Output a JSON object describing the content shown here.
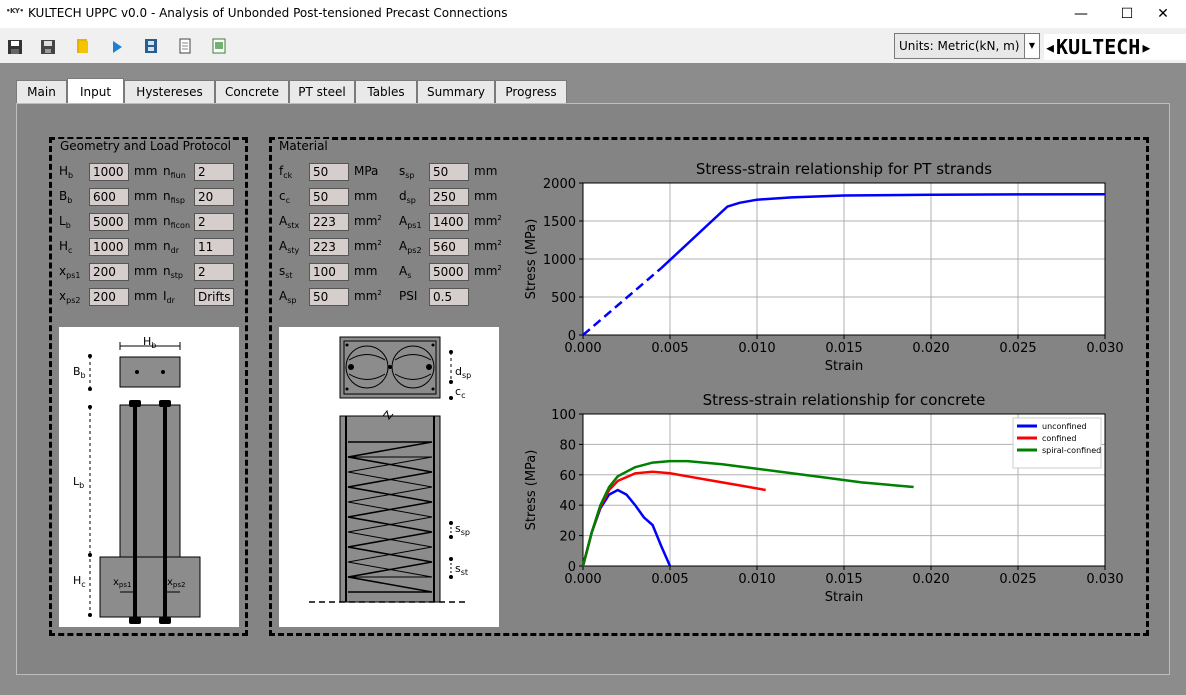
{
  "window": {
    "icon_text": "•KY•",
    "title": "KULTECH UPPC v0.0 - Analysis of Unbonded Post-tensioned Precast Connections",
    "minimize": "—",
    "maximize": "☐",
    "close": "✕"
  },
  "toolbar": {
    "units_label": "Units: Metric(kN, m)",
    "units_arrow": "▼",
    "logo": "◂KULTECH▸"
  },
  "tabs": [
    "Main",
    "Input",
    "Hystereses",
    "Concrete",
    "PT steel",
    "Tables",
    "Summary",
    "Progress"
  ],
  "active_tab": "Input",
  "geometry": {
    "title": "Geometry and Load Protocol",
    "rows": [
      {
        "l1": "H",
        "s1": "b",
        "v1": "1000",
        "u1": "mm",
        "l2": "n",
        "s2": "fiun",
        "v2": "2"
      },
      {
        "l1": "B",
        "s1": "b",
        "v1": "600",
        "u1": "mm",
        "l2": "n",
        "s2": "fisp",
        "v2": "20"
      },
      {
        "l1": "L",
        "s1": "b",
        "v1": "5000",
        "u1": "mm",
        "l2": "n",
        "s2": "ficon",
        "v2": "2"
      },
      {
        "l1": "H",
        "s1": "c",
        "v1": "1000",
        "u1": "mm",
        "l2": "n",
        "s2": "dr",
        "v2": "11"
      },
      {
        "l1": "x",
        "s1": "ps1",
        "v1": "200",
        "u1": "mm",
        "l2": "n",
        "s2": "stp",
        "v2": "2"
      },
      {
        "l1": "x",
        "s1": "ps2",
        "v1": "200",
        "u1": "mm",
        "l2": "I",
        "s2": "dr",
        "v2": "Drifts"
      }
    ],
    "drawing": {
      "hb_main": "H",
      "hb_sub": "b",
      "bb_main": "B",
      "bb_sub": "b",
      "lb_main": "L",
      "lb_sub": "b",
      "hc_main": "H",
      "hc_sub": "c",
      "xps1_main": "x",
      "xps1_sub": "ps1",
      "xps2_main": "x",
      "xps2_sub": "ps2"
    }
  },
  "material": {
    "title": "Material",
    "rows": [
      {
        "l1": "f",
        "s1": "ck",
        "v1": "50",
        "u1": "MPa",
        "l2": "s",
        "s2": "sp",
        "v2": "50",
        "u2": "mm"
      },
      {
        "l1": "c",
        "s1": "c",
        "v1": "50",
        "u1": "mm",
        "l2": "d",
        "s2": "sp",
        "v2": "250",
        "u2": "mm"
      },
      {
        "l1": "A",
        "s1": "stx",
        "v1": "223",
        "u1": "mm",
        "sup1": "2",
        "l2": "A",
        "s2": "ps1",
        "v2": "1400",
        "u2": "mm",
        "sup2": "2"
      },
      {
        "l1": "A",
        "s1": "sty",
        "v1": "223",
        "u1": "mm",
        "sup1": "2",
        "l2": "A",
        "s2": "ps2",
        "v2": "560",
        "u2": "mm",
        "sup2": "2"
      },
      {
        "l1": "s",
        "s1": "st",
        "v1": "100",
        "u1": "mm",
        "l2": "A",
        "s2": "s",
        "v2": "5000",
        "u2": "mm",
        "sup2": "2"
      },
      {
        "l1": "A",
        "s1": "sp",
        "v1": "50",
        "u1": "mm",
        "sup1": "2",
        "l2": "PSI",
        "s2": "",
        "v2": "0.5",
        "u2": ""
      }
    ],
    "drawing": {
      "dsp_main": "d",
      "dsp_sub": "sp",
      "cc_main": "c",
      "cc_sub": "c",
      "ssp_main": "s",
      "ssp_sub": "sp",
      "sst_main": "s",
      "sst_sub": "st"
    }
  },
  "chart_data": [
    {
      "type": "line",
      "title": "Stress-strain relationship for PT strands",
      "xlabel": "Strain",
      "ylabel": "Stress (MPa)",
      "xlim": [
        0,
        0.03
      ],
      "ylim": [
        0,
        2000
      ],
      "xticks": [
        "0.000",
        "0.005",
        "0.010",
        "0.015",
        "0.020",
        "0.025",
        "0.030"
      ],
      "yticks": [
        "0",
        "500",
        "1000",
        "1500",
        "2000"
      ],
      "grid": true,
      "series": [
        {
          "color": "#0000ff",
          "dashed": true,
          "x": [
            0,
            0.0045
          ],
          "y": [
            0,
            880
          ]
        },
        {
          "color": "#0000ff",
          "dashed": false,
          "x": [
            0.0045,
            0.0083,
            0.009,
            0.01,
            0.012,
            0.015,
            0.02,
            0.025,
            0.03
          ],
          "y": [
            880,
            1690,
            1740,
            1780,
            1810,
            1835,
            1845,
            1850,
            1852
          ]
        }
      ]
    },
    {
      "type": "line",
      "title": "Stress-strain relationship for concrete",
      "xlabel": "Strain",
      "ylabel": "Stress (MPa)",
      "xlim": [
        0,
        0.03
      ],
      "ylim": [
        0,
        100
      ],
      "xticks": [
        "0.000",
        "0.005",
        "0.010",
        "0.015",
        "0.020",
        "0.025",
        "0.030"
      ],
      "yticks": [
        "0",
        "20",
        "40",
        "60",
        "80",
        "100"
      ],
      "grid": true,
      "legend_position": "top-right",
      "series": [
        {
          "name": "unconfined",
          "color": "#0000ff",
          "x": [
            0,
            0.0005,
            0.001,
            0.0015,
            0.002,
            0.0025,
            0.003,
            0.0035,
            0.004,
            0.0045,
            0.005
          ],
          "y": [
            0,
            22,
            38,
            47,
            50,
            47,
            40,
            32,
            27,
            13,
            0
          ]
        },
        {
          "name": "confined",
          "color": "#ff0000",
          "x": [
            0,
            0.0005,
            0.001,
            0.0015,
            0.002,
            0.003,
            0.004,
            0.005,
            0.006,
            0.007,
            0.008,
            0.009,
            0.0105
          ],
          "y": [
            0,
            22,
            39,
            50,
            56,
            61,
            62,
            61,
            59,
            57,
            55,
            53,
            50
          ]
        },
        {
          "name": "spiral-confined",
          "color": "#008000",
          "x": [
            0,
            0.0005,
            0.001,
            0.0015,
            0.002,
            0.003,
            0.004,
            0.005,
            0.006,
            0.008,
            0.01,
            0.012,
            0.014,
            0.016,
            0.019
          ],
          "y": [
            0,
            22,
            40,
            52,
            59,
            65,
            68,
            69,
            69,
            67,
            64,
            61,
            58,
            55,
            52
          ]
        }
      ]
    }
  ]
}
